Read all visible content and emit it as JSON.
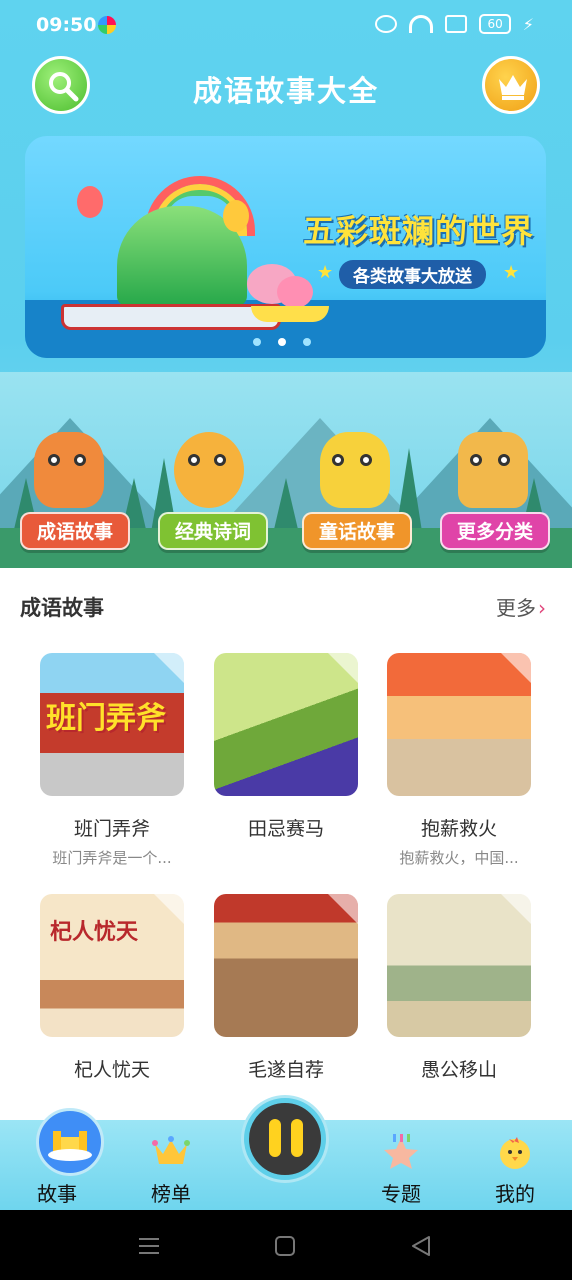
{
  "status_bar": {
    "time": "09:50",
    "battery": "60"
  },
  "header": {
    "title": "成语故事大全",
    "search_icon": "search-icon",
    "vip_icon": "crown-icon"
  },
  "banner": {
    "headline": "五彩斑斓的世界",
    "subtitle": "各类故事大放送",
    "page_count": 3,
    "active_index": 1
  },
  "categories": [
    {
      "label": "成语故事",
      "color": "#e85a3a",
      "animal": "fox"
    },
    {
      "label": "经典诗词",
      "color": "#7fc232",
      "animal": "lion"
    },
    {
      "label": "童话故事",
      "color": "#f0952a",
      "animal": "owl"
    },
    {
      "label": "更多分类",
      "color": "#e044a8",
      "animal": "giraffe"
    }
  ],
  "section": {
    "title": "成语故事",
    "more_label": "更多",
    "stories": [
      {
        "name": "班门弄斧",
        "desc": "班门弄斧是一个...",
        "thumb_text": "班门弄斧",
        "bg": "#c43b2c"
      },
      {
        "name": "田忌赛马",
        "desc": "",
        "thumb_text": "",
        "bg": "#b8d86a"
      },
      {
        "name": "抱薪救火",
        "desc": "抱薪救火，中国...",
        "thumb_text": "",
        "bg": "#e8c79a"
      },
      {
        "name": "杞人忧天",
        "desc": "",
        "thumb_text": "杞人忧天",
        "bg": "#f3e2c6"
      },
      {
        "name": "毛遂自荐",
        "desc": "",
        "thumb_text": "",
        "bg": "#a67a54"
      },
      {
        "name": "愚公移山",
        "desc": "",
        "thumb_text": "",
        "bg": "#e6dfc3"
      }
    ]
  },
  "tabbar": {
    "tabs": [
      {
        "label": "故事",
        "icon": "castle-icon",
        "active": true
      },
      {
        "label": "榜单",
        "icon": "crown-icon",
        "active": false
      },
      {
        "label": "专题",
        "icon": "star-icon",
        "active": false
      },
      {
        "label": "我的",
        "icon": "chick-icon",
        "active": false
      }
    ],
    "player_icon": "pause-icon"
  }
}
